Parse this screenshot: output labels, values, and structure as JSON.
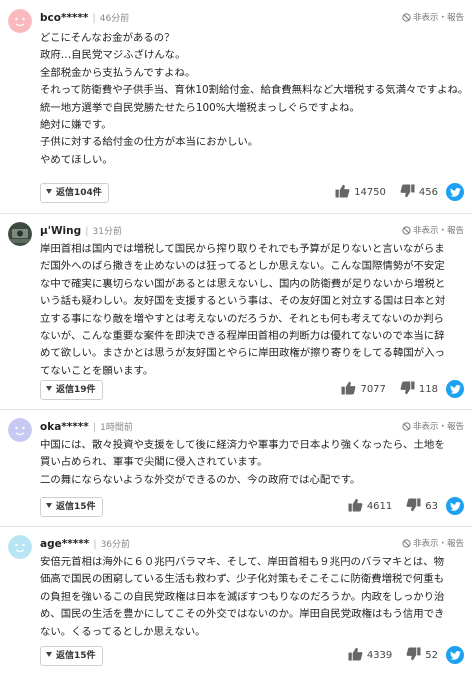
{
  "comments": [
    {
      "user": "bco*****",
      "time": "46分前",
      "report": "非表示・報告",
      "lines": [
        "どこにそんなお金があるの？",
        "政府…自民党マジふざけんな。",
        "全部税金から支払うんですよね。",
        "それって防衛費や子供手当、育休10割給付金、給食費無料など大増税する気満々ですよね。",
        "統一地方選挙で自民党勝たせたら100%大増税まっしぐらですよね。",
        "絶対に嫌です。",
        "子供に対する給付金の仕方が本当におかしい。",
        "やめてほしい。"
      ],
      "reply": "返信104件",
      "likes": "14750",
      "dislikes": "456"
    },
    {
      "user": "μ'Wing",
      "time": "31分前",
      "report": "非表示・報告",
      "lines": [
        "岸田首相は国内では増税して国民から搾り取りそれでも予算が足りないと言いながらま",
        "だ国外へのばら撒きを止めないのは狂ってるとしか思えない。こんな国際情勢が不安定",
        "な中で確実に裏切らない国があるとは思えないし、国内の防衛費が足りないから増税と",
        "いう話も疑わしい。友好国を支援するという事は、その友好国と対立する国は日本と対",
        "立する事になり敵を増やすとは考えないのだろうか、それとも何も考えてないのか判ら",
        "ないが、こんな重要な案件を即決できる程岸田首相の判断力は優れてないので本当に辞",
        "めて欲しい。まさかとは思うが友好国とやらに岸田政権が擦り寄りをしてる韓国が入っ",
        "てないことを願います。"
      ],
      "reply": "返信19件",
      "likes": "7077",
      "dislikes": "118"
    },
    {
      "user": "oka*****",
      "time": "1時間前",
      "report": "非表示・報告",
      "lines": [
        "中国には、散々投資や支援をして後に経済力や軍事力で日本より強くなったら、土地を",
        "買い占められ、軍事で尖閣に侵入されています。",
        "二の舞にならないような外交ができるのか、今の政府では心配です。"
      ],
      "reply": "返信15件",
      "likes": "4611",
      "dislikes": "63"
    },
    {
      "user": "age*****",
      "time": "36分前",
      "report": "非表示・報告",
      "lines": [
        "安倍元首相は海外に６０兆円バラマキ、そして、岸田首相も９兆円のバラマキとは、物",
        "価高で国民の困窮している生活も救わず、少子化対策もそこそこに防衛費増税で何重も",
        "の負担を強いるこの自民党政権は日本を滅ぼすつもりなのだろうか。内政をしっかり治",
        "め、国民の生活を豊かにしてこその外交ではないのか。岸田自民党政権はもう信用でき",
        "ない。くるってるとしか思えない。"
      ],
      "reply": "返信15件",
      "likes": "4339",
      "dislikes": "52"
    }
  ],
  "icons": {
    "thumb_up": "thumbs-up-icon",
    "thumb_down": "thumbs-down-icon",
    "share": "twitter-icon",
    "report": "hide-report-icon",
    "expand": "triangle-down-icon"
  },
  "colors": {
    "twitter": "#1da1f2",
    "avatar_pink": "#f9b9bd",
    "avatar_lavender": "#c7c9f3",
    "avatar_aqua": "#b8e4f4",
    "avatar_photo": "#3c4a3f"
  }
}
